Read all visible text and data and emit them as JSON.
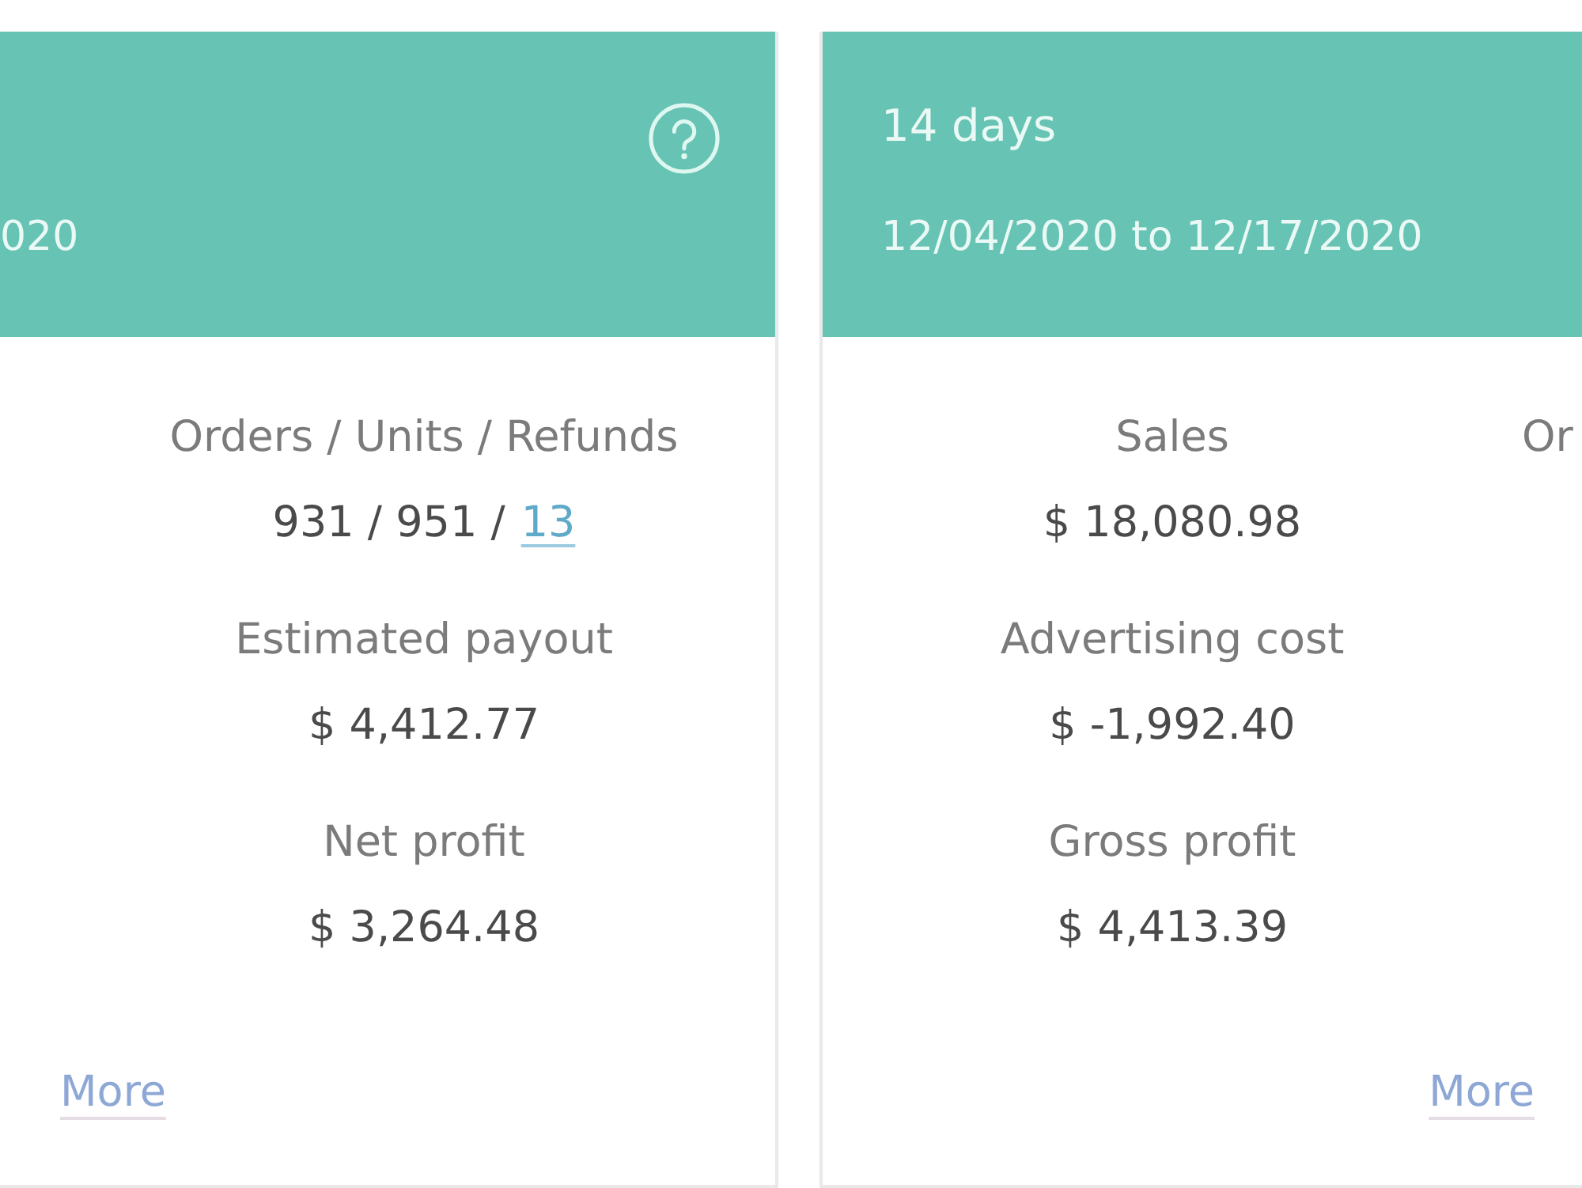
{
  "cards": [
    {
      "date_range": "020",
      "help": true,
      "columns": [
        {
          "metrics": [
            {
              "label": "Orders / Units / Refunds",
              "value": "931 / 951 /",
              "link": "13"
            },
            {
              "label": "Estimated payout",
              "value": "$ 4,412.77"
            },
            {
              "label": "Net profit",
              "value": "$ 3,264.48"
            }
          ]
        }
      ],
      "more": "More"
    },
    {
      "title": "14 days",
      "date_range": "12/04/2020 to 12/17/2020",
      "columns": [
        {
          "metrics": [
            {
              "label": "Sales",
              "value": "$ 18,080.98"
            },
            {
              "label": "Advertising cost",
              "value": "$ -1,992.40"
            },
            {
              "label": "Gross profit",
              "value": "$ 4,413.39"
            }
          ]
        },
        {
          "metrics": [
            {
              "label": "Or"
            }
          ]
        }
      ],
      "more": "More"
    }
  ]
}
